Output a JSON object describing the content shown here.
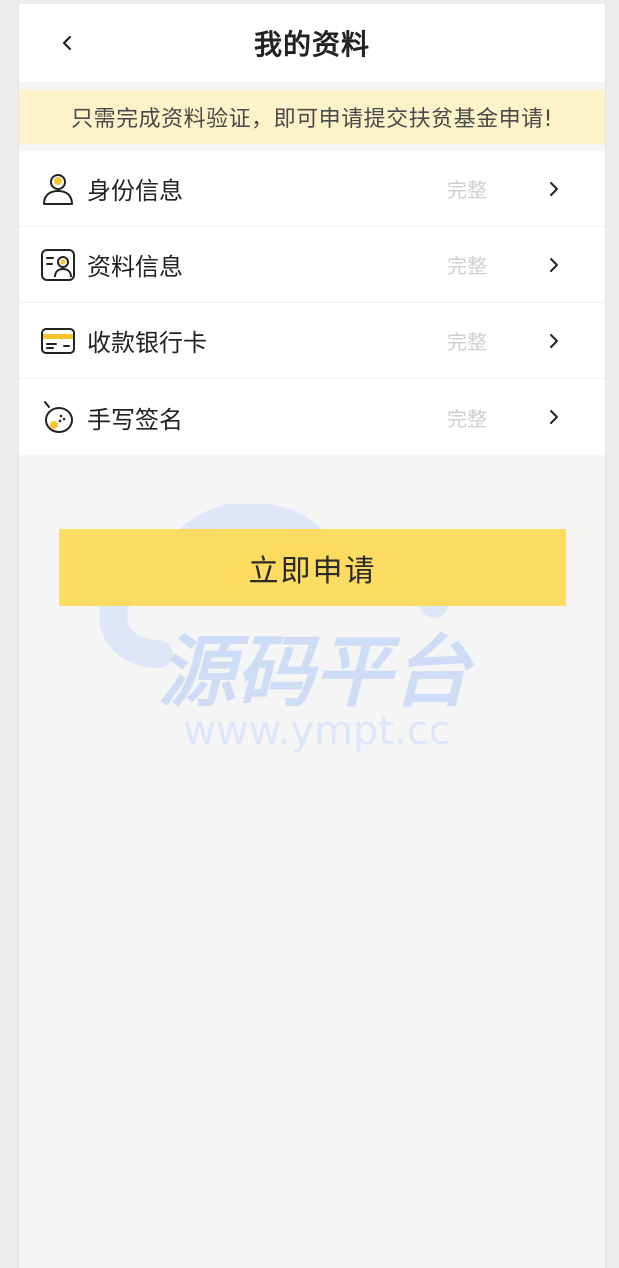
{
  "header": {
    "title": "我的资料"
  },
  "notice": {
    "text": "只需完成资料验证，即可申请提交扶贫基金申请!"
  },
  "items": [
    {
      "label": "身份信息",
      "status": "完整",
      "icon": "user-icon"
    },
    {
      "label": "资料信息",
      "status": "完整",
      "icon": "profile-card-icon"
    },
    {
      "label": "收款银行卡",
      "status": "完整",
      "icon": "bank-card-icon"
    },
    {
      "label": "手写签名",
      "status": "完整",
      "icon": "signature-icon"
    }
  ],
  "apply_button": {
    "label": "立即申请"
  },
  "watermark": {
    "brand": "源码平台",
    "url": "www.ympt.cc"
  },
  "colors": {
    "accent": "#fcda5a",
    "notice_bg": "#fdf3c8",
    "icon_yellow": "#f7c52a"
  }
}
